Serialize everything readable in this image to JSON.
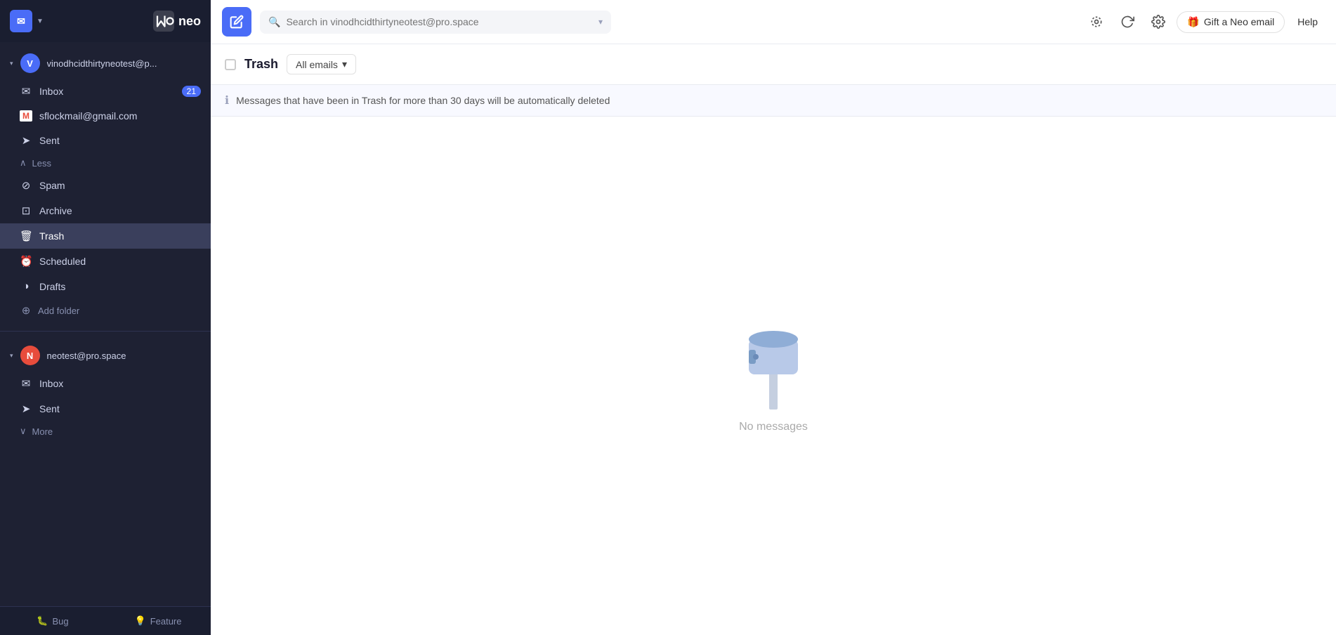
{
  "sidebar": {
    "app_name": "neo",
    "accounts": [
      {
        "id": "account-1",
        "avatar_letter": "V",
        "avatar_color": "#4a6cf7",
        "email": "vinodhcidthirtyneotest@p...",
        "email_full": "vinodhcidthirtyneotest@pro.space",
        "nav_items": [
          {
            "id": "inbox",
            "label": "Inbox",
            "icon": "✉",
            "badge": "21"
          },
          {
            "id": "gmail",
            "label": "sflockmail@gmail.com",
            "icon": "M",
            "badge": ""
          },
          {
            "id": "sent",
            "label": "Sent",
            "icon": "➤",
            "badge": ""
          },
          {
            "id": "less",
            "label": "Less",
            "toggle": true
          },
          {
            "id": "spam",
            "label": "Spam",
            "icon": "⊘",
            "badge": ""
          },
          {
            "id": "archive",
            "label": "Archive",
            "icon": "⊡",
            "badge": ""
          },
          {
            "id": "trash",
            "label": "Trash",
            "icon": "🗑",
            "badge": "",
            "active": true
          },
          {
            "id": "scheduled",
            "label": "Scheduled",
            "icon": "⊙",
            "badge": ""
          },
          {
            "id": "drafts",
            "label": "Drafts",
            "icon": "◑",
            "badge": ""
          },
          {
            "id": "add-folder",
            "label": "Add folder",
            "icon": "⊕",
            "add": true
          }
        ]
      },
      {
        "id": "account-2",
        "avatar_letter": "N",
        "avatar_color": "#e74c3c",
        "email": "neotest@pro.space",
        "nav_items": [
          {
            "id": "inbox2",
            "label": "Inbox",
            "icon": "✉",
            "badge": ""
          },
          {
            "id": "sent2",
            "label": "Sent",
            "icon": "➤",
            "badge": ""
          },
          {
            "id": "more",
            "label": "More",
            "toggle": true
          }
        ]
      }
    ]
  },
  "topbar": {
    "search_placeholder": "Search in vinodhcidthirtyneotest@pro.space",
    "gift_label": "Gift a Neo email",
    "help_label": "Help"
  },
  "content": {
    "title": "Trash",
    "filter_label": "All emails",
    "info_message": "Messages that have been in Trash for more than 30 days will be automatically deleted",
    "empty_message": "No messages"
  },
  "bottom_bar": {
    "bug_label": "Bug",
    "feature_label": "Feature"
  }
}
